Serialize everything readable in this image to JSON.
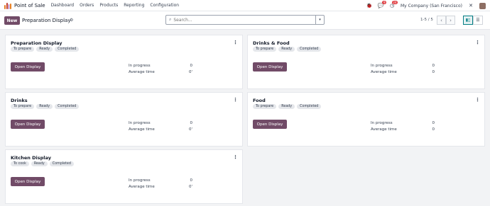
{
  "nav": {
    "app_name": "Point of Sale",
    "menu": [
      "Dashboard",
      "Orders",
      "Products",
      "Reporting",
      "Configuration"
    ],
    "chat_count": "9",
    "activity_count": "24",
    "company": "My Company (San Francisco)"
  },
  "control": {
    "new_label": "New",
    "title": "Preparation Display",
    "search_placeholder": "Search...",
    "pager": "1-5 / 5"
  },
  "cards": [
    {
      "title": "Preparation Display",
      "tags": [
        "To prepare",
        "Ready",
        "Completed"
      ],
      "button": "Open Display",
      "in_progress_label": "In progress",
      "in_progress": "0",
      "avg_label": "Average time",
      "avg": "0'"
    },
    {
      "title": "Drinks & Food",
      "tags": [
        "To prepare",
        "Ready",
        "Completed"
      ],
      "button": "Open Display",
      "in_progress_label": "In progress",
      "in_progress": "0",
      "avg_label": "Average time",
      "avg": "0"
    },
    {
      "title": "Drinks",
      "tags": [
        "To prepare",
        "Ready",
        "Completed"
      ],
      "button": "Open Display",
      "in_progress_label": "In progress",
      "in_progress": "0",
      "avg_label": "Average time",
      "avg": "0'"
    },
    {
      "title": "Food",
      "tags": [
        "To prepare",
        "Ready",
        "Completed"
      ],
      "button": "Open Display",
      "in_progress_label": "In progress",
      "in_progress": "0",
      "avg_label": "Average time",
      "avg": "0"
    },
    {
      "title": "Kitchen Display",
      "tags": [
        "To cook",
        "Ready",
        "Completed"
      ],
      "button": "Open Display",
      "in_progress_label": "In progress",
      "in_progress": "0",
      "avg_label": "Average time",
      "avg": "0'"
    }
  ],
  "colors": {
    "brand": "#714b67",
    "badge": "#e0393e",
    "accent": "#017e84"
  }
}
